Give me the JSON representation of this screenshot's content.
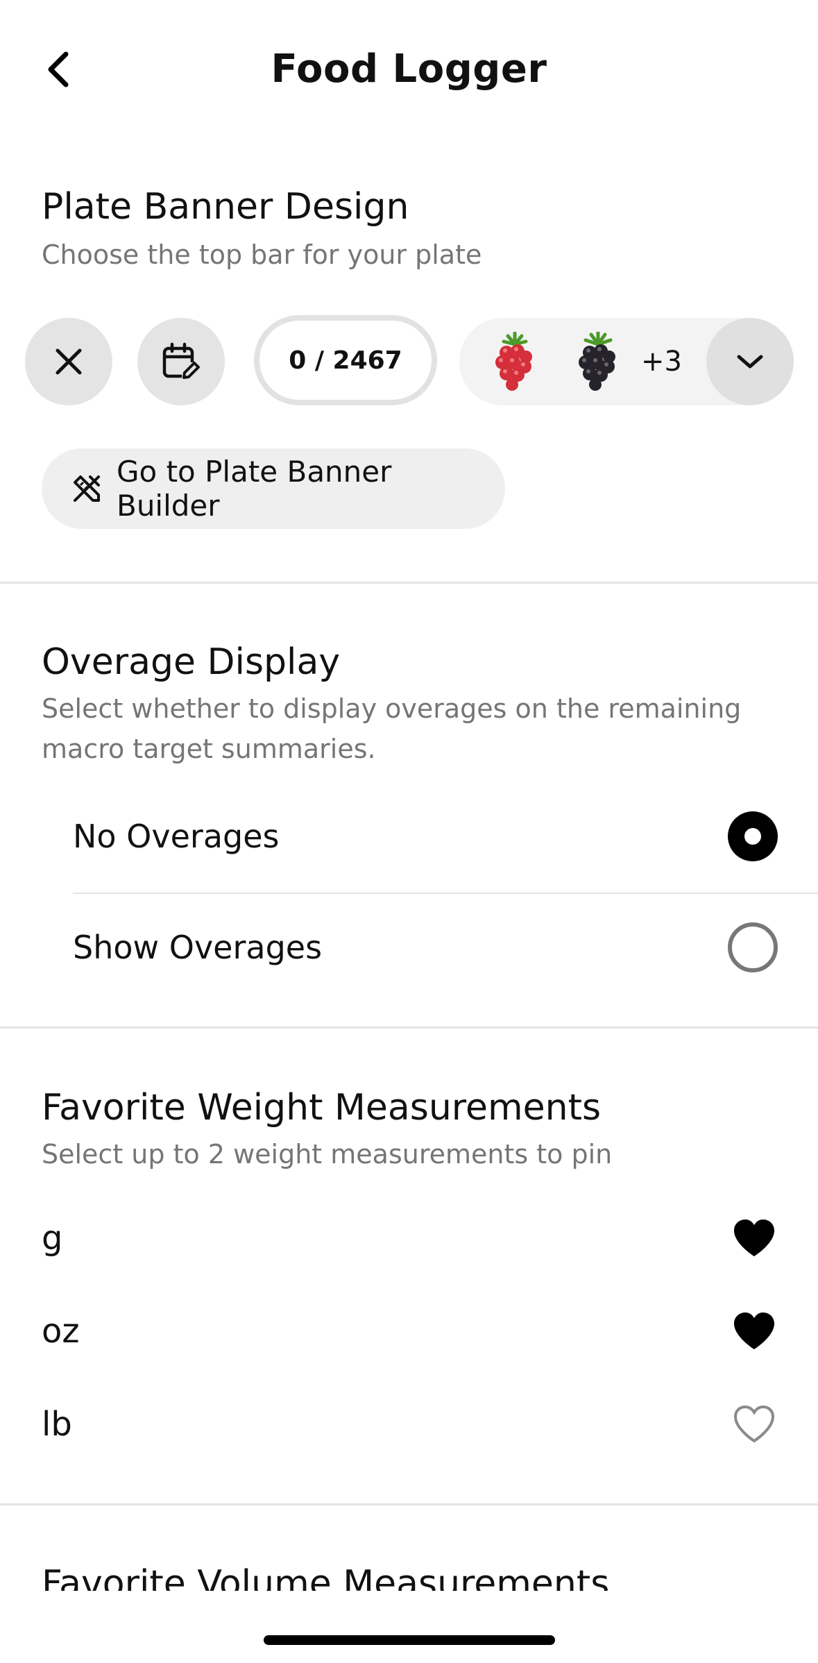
{
  "header": {
    "title": "Food Logger"
  },
  "plate_banner": {
    "title": "Plate Banner Design",
    "subtitle": "Choose the top bar for your plate",
    "count": "0 / 2467",
    "more_count": "+3",
    "builder_label": "Go to Plate Banner Builder"
  },
  "overage": {
    "title": "Overage Display",
    "subtitle": "Select whether to display overages on the remaining macro target summaries.",
    "options": [
      {
        "label": "No Overages",
        "selected": true
      },
      {
        "label": "Show Overages",
        "selected": false
      }
    ]
  },
  "weight": {
    "title": "Favorite Weight Measurements",
    "subtitle": "Select up to 2 weight measurements to pin",
    "units": [
      {
        "label": "g",
        "favorite": true
      },
      {
        "label": "oz",
        "favorite": true
      },
      {
        "label": "lb",
        "favorite": false
      }
    ]
  },
  "volume": {
    "title": "Favorite Volume Measurements"
  },
  "icons": {
    "back": "chevron-left-icon",
    "close": "close-icon",
    "calendar_edit": "calendar-edit-icon",
    "raspberry": "raspberry-icon",
    "blackberry": "blackberry-icon",
    "dropdown": "chevron-down-icon",
    "builder": "design-tools-icon",
    "heart_filled": "heart-filled-icon",
    "heart_outline": "heart-outline-icon"
  },
  "colors": {
    "accent": "#000000",
    "chip_bg": "#e4e4e4",
    "subtitle": "#757575",
    "divider": "#e4e4e4"
  }
}
